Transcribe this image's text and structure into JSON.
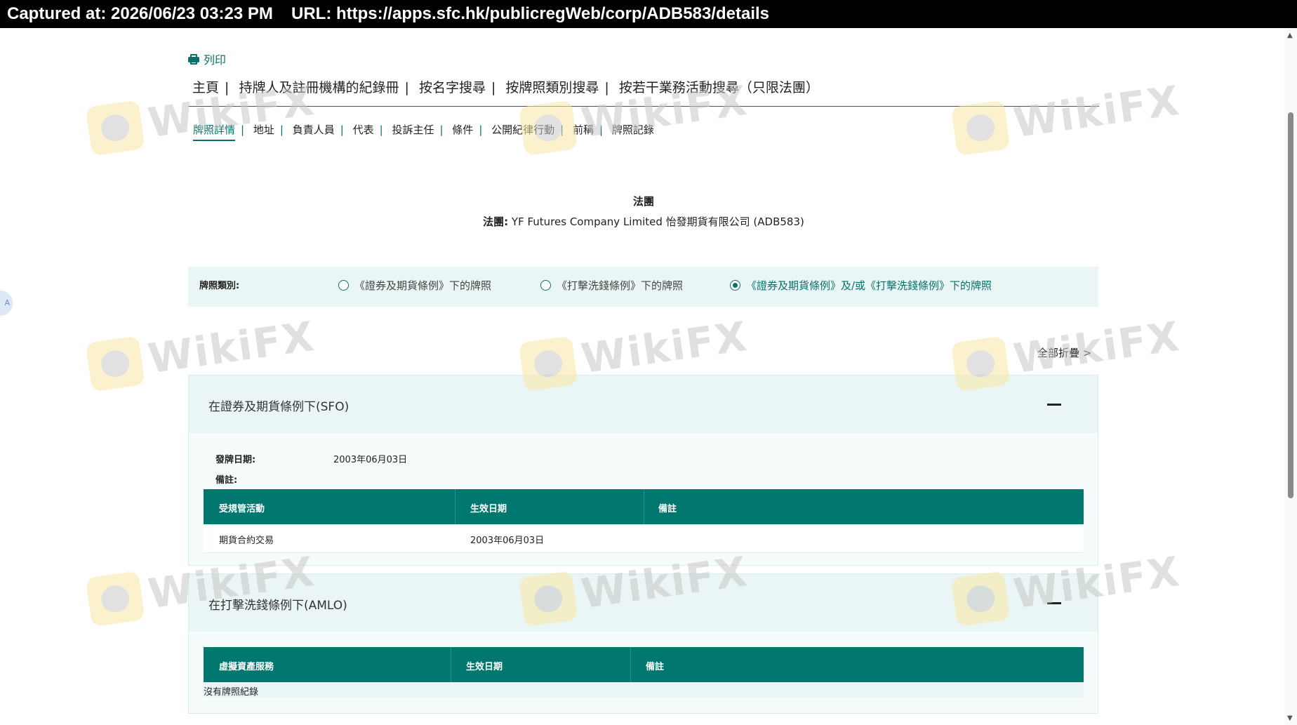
{
  "capture": {
    "timestamp": "Captured at: 2026/06/23 03:23 PM",
    "url": "URL: https://apps.sfc.hk/publicregWeb/corp/ADB583/details"
  },
  "print_label": "列印",
  "top_nav": [
    "主頁",
    "持牌人及註冊機構的紀錄冊",
    "按名字搜尋",
    "按牌照類別搜尋",
    "按若干業務活動搜尋（只限法團）"
  ],
  "sub_tabs": [
    "牌照詳情",
    "地址",
    "負責人員",
    "代表",
    "投訴主任",
    "條件",
    "公開紀律行動",
    "前稱",
    "牌照記錄"
  ],
  "entity": {
    "type": "法團",
    "name_label": "法團:",
    "name": "YF Futures Company Limited 怡發期貨有限公司 (ADB583)"
  },
  "license_type": {
    "label": "牌照類別:",
    "options": [
      {
        "label": "《證券及期貨條例》下的牌照",
        "selected": false
      },
      {
        "label": "《打擊洗錢條例》下的牌照",
        "selected": false
      },
      {
        "label": "《證券及期貨條例》及/或《打擊洗錢條例》下的牌照",
        "selected": true
      }
    ]
  },
  "collapse_all": "全部折疊 >",
  "sfo": {
    "title": "在證券及期貨條例下(SFO)",
    "issue_date_label": "發牌日期:",
    "issue_date": "2003年06月03日",
    "remarks_label": "備註:",
    "columns": [
      "受規管活動",
      "生效日期",
      "備註"
    ],
    "rows": [
      [
        "期貨合約交易",
        "2003年06月03日",
        ""
      ]
    ]
  },
  "amlo": {
    "title": "在打擊洗錢條例下(AMLO)",
    "columns": [
      "虛擬資產服務",
      "生效日期",
      "備註"
    ],
    "no_record": "沒有牌照紀錄"
  },
  "watermark_text": "WikiFX",
  "side_bubble_label": "A",
  "colors": {
    "accent": "#00776f",
    "panel": "#e9f6f5",
    "watermark_logo": "#f9e8a5"
  }
}
